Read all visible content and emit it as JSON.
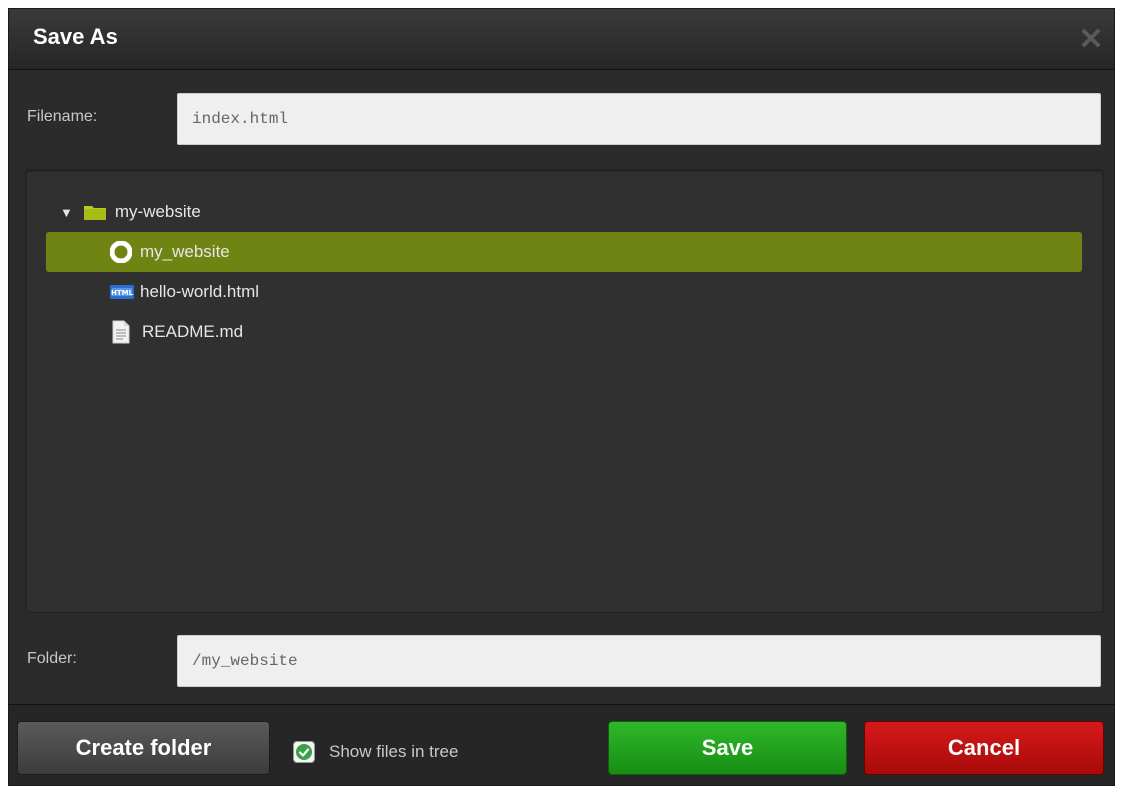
{
  "dialog": {
    "title": "Save As"
  },
  "filename": {
    "label": "Filename:",
    "value": "index.html"
  },
  "tree": {
    "root": {
      "label": "my-website",
      "expanded": true,
      "icon": "folder-icon"
    },
    "items": [
      {
        "label": "my_website",
        "icon": "circle-icon",
        "selected": true
      },
      {
        "label": "hello-world.html",
        "icon": "html-file-icon",
        "selected": false
      },
      {
        "label": "README.md",
        "icon": "document-icon",
        "selected": false
      }
    ]
  },
  "folder": {
    "label": "Folder:",
    "value": "/my_website"
  },
  "footer": {
    "create_folder_label": "Create folder",
    "show_files_label": "Show files in tree",
    "show_files_checked": true,
    "save_label": "Save",
    "cancel_label": "Cancel"
  },
  "colors": {
    "selected_row": "#6f8412",
    "save": "#1fa31b",
    "cancel": "#c11010",
    "folder_icon": "#b6cc1e"
  }
}
